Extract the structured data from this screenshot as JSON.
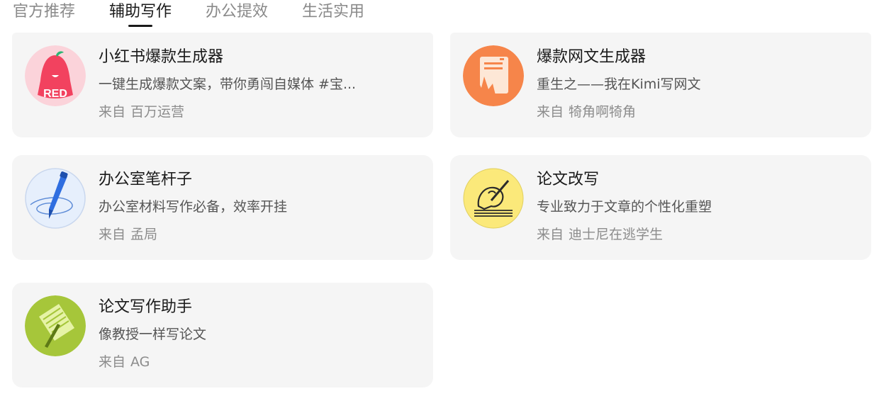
{
  "tabs": [
    {
      "label": "官方推荐",
      "active": false
    },
    {
      "label": "辅助写作",
      "active": true
    },
    {
      "label": "办公提效",
      "active": false
    },
    {
      "label": "生活实用",
      "active": false
    }
  ],
  "cards": [
    {
      "title": "小红书爆款生成器",
      "description": "一键生成爆款文案，带你勇闯自媒体 #宝...",
      "author_prefix": "来自",
      "author": "百万运营",
      "icon": "red-bell-icon",
      "icon_text": "RED"
    },
    {
      "title": "爆款网文生成器",
      "description": "重生之——我在Kimi写网文",
      "author_prefix": "来自",
      "author": "犄角啊犄角",
      "icon": "web-novel-document-icon"
    },
    {
      "title": "办公室笔杆子",
      "description": "办公室材料写作必备，效率开挂",
      "author_prefix": "来自",
      "author": "孟局",
      "icon": "fountain-pen-icon"
    },
    {
      "title": "论文改写",
      "description": "专业致力于文章的个性化重塑",
      "author_prefix": "来自",
      "author": "迪士尼在逃学生",
      "icon": "hand-writing-icon"
    },
    {
      "title": "论文写作助手",
      "description": "像教授一样写论文",
      "author_prefix": "来自",
      "author": "AG",
      "icon": "notepad-pen-icon"
    }
  ],
  "colors": {
    "card_background": "#f5f5f5",
    "tab_active": "#1a1a1a",
    "tab_inactive": "#8a8a8a"
  }
}
